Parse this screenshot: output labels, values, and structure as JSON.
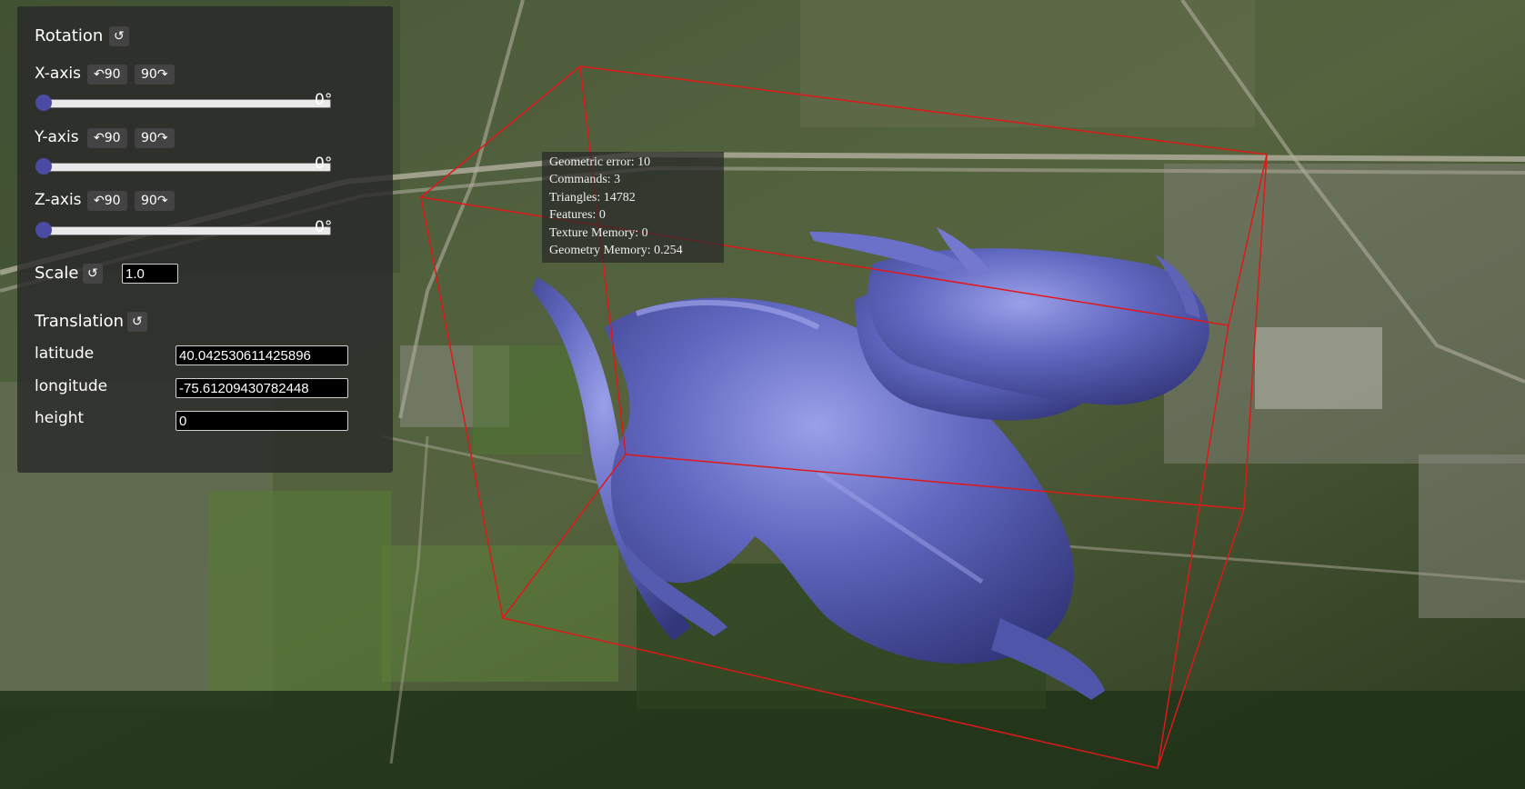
{
  "rotation": {
    "title": "Rotation",
    "reset_icon": "↺",
    "axes": [
      {
        "label": "X-axis",
        "ccw": "↶90",
        "cw": "90↷",
        "value": "0°",
        "level": 0
      },
      {
        "label": "Y-axis",
        "ccw": "↶90",
        "cw": "90↷",
        "value": "0°",
        "level": 0
      },
      {
        "label": "Z-axis",
        "ccw": "↶90",
        "cw": "90↷",
        "value": "0°",
        "level": 0
      }
    ]
  },
  "scale": {
    "label": "Scale",
    "reset_icon": "↺",
    "value": "1.0"
  },
  "translation": {
    "title": "Translation",
    "reset_icon": "↺",
    "fields": [
      {
        "label": "latitude",
        "value": "40.042530611425896"
      },
      {
        "label": "longitude",
        "value": "-75.61209430782448"
      },
      {
        "label": "height",
        "value": "0"
      }
    ]
  },
  "stats": [
    "Geometric error: 10",
    "Commands: 3",
    "Triangles: 14782",
    "Features: 0",
    "Texture Memory: 0",
    "Geometry Memory: 0.254"
  ],
  "colors": {
    "model": "#5a5fb0",
    "bounding_box": "#e01818",
    "slider_thumb": "#4b4ba3"
  }
}
